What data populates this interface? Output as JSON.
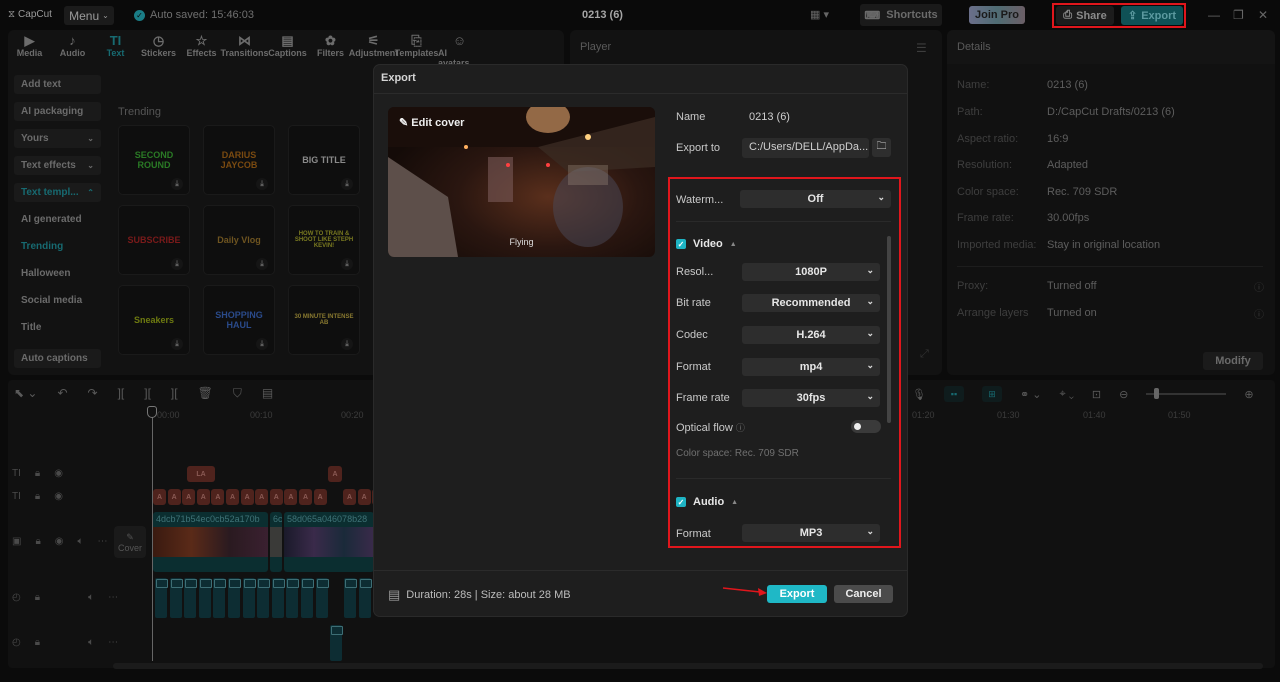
{
  "titlebar": {
    "app_name": "CapCut",
    "menu_label": "Menu",
    "autosave": "Auto saved: 15:46:03",
    "project_title": "0213 (6)",
    "shortcuts_label": "Shortcuts",
    "join_pro_label": "Join Pro",
    "share_label": "Share",
    "export_label": "Export"
  },
  "tool_tabs": [
    {
      "icon": "media-icon",
      "glyph": "▶",
      "label": "Media"
    },
    {
      "icon": "audio-icon",
      "glyph": "♪",
      "label": "Audio"
    },
    {
      "icon": "text-icon",
      "glyph": "TI",
      "label": "Text",
      "active": true
    },
    {
      "icon": "stickers-icon",
      "glyph": "◷",
      "label": "Stickers"
    },
    {
      "icon": "effects-icon",
      "glyph": "☆",
      "label": "Effects"
    },
    {
      "icon": "transitions-icon",
      "glyph": "⋈",
      "label": "Transitions"
    },
    {
      "icon": "captions-icon",
      "glyph": "▤",
      "label": "Captions"
    },
    {
      "icon": "filters-icon",
      "glyph": "✿",
      "label": "Filters"
    },
    {
      "icon": "adjustment-icon",
      "glyph": "⚟",
      "label": "Adjustment"
    },
    {
      "icon": "templates-icon",
      "glyph": "⎘",
      "label": "Templates"
    },
    {
      "icon": "ai-avatars-icon",
      "glyph": "☺",
      "label": "AI avatars"
    }
  ],
  "text_sidebar": [
    {
      "label": "Add text",
      "style": "button"
    },
    {
      "label": "AI packaging",
      "style": "button"
    },
    {
      "label": "Yours",
      "style": "button",
      "chevron": "⌄"
    },
    {
      "label": "Text effects",
      "style": "button",
      "chevron": "⌄"
    },
    {
      "label": "Text templ...",
      "style": "button teal",
      "chevron": "⌃"
    },
    {
      "label": "AI generated",
      "style": "plain"
    },
    {
      "label": "Trending",
      "style": "plain teal"
    },
    {
      "label": "Halloween",
      "style": "plain"
    },
    {
      "label": "Social media",
      "style": "plain"
    },
    {
      "label": "Title",
      "style": "plain"
    },
    {
      "label": "Auto captions",
      "style": "button"
    }
  ],
  "trending_label": "Trending",
  "templates": [
    {
      "text": "SECOND ROUND",
      "color": "#2a7a25"
    },
    {
      "text": "DARIUS JAYCOB",
      "color": "#7a4a10"
    },
    {
      "text": "BIG TITLE",
      "color": "#8a8a8a"
    },
    {
      "text": "SUBSCRIBE",
      "color": "#7a1a1a"
    },
    {
      "text": "Daily Vlog",
      "color": "#6e5420"
    },
    {
      "text": "HOW TO TRAIN & SHOOT LIKE STEPH KEVIN!",
      "color": "#7a7a20"
    },
    {
      "text": "Sneakers",
      "color": "#6e7a10"
    },
    {
      "text": "SHOPPING HAUL",
      "color": "#2a4a8a"
    },
    {
      "text": "30 MINUTE INTENSE AB",
      "color": "#8a7a30"
    }
  ],
  "player": {
    "label": "Player"
  },
  "details": {
    "title": "Details",
    "rows": [
      {
        "key": "Name:",
        "value": "0213 (6)"
      },
      {
        "key": "Path:",
        "value": "D:/CapCut Drafts/0213 (6)"
      },
      {
        "key": "Aspect ratio:",
        "value": "16:9"
      },
      {
        "key": "Resolution:",
        "value": "Adapted"
      },
      {
        "key": "Color space:",
        "value": "Rec. 709 SDR"
      },
      {
        "key": "Frame rate:",
        "value": "30.00fps"
      },
      {
        "key": "Imported media:",
        "value": "Stay in original location"
      },
      {
        "key": "Proxy:",
        "value": "Turned off"
      },
      {
        "key": "Arrange layers",
        "value": "Turned on"
      }
    ],
    "modify_label": "Modify"
  },
  "timeline": {
    "ruler": [
      "00:00",
      "00:10",
      "00:20",
      "01:20",
      "01:30",
      "01:40",
      "01:50"
    ],
    "cover_label": "Cover",
    "clip_names": [
      "4dcb71b54ec0cb52a170b",
      "6c",
      "58d065a046078b28"
    ],
    "text_clip_label": "A",
    "lyric_clip_label": "LA"
  },
  "export_dialog": {
    "title": "Export",
    "edit_cover": "Edit cover",
    "cover_caption": "Flying",
    "name_label": "Name",
    "name_value": "0213 (6)",
    "export_to_label": "Export to",
    "export_to_value": "C:/Users/DELL/AppDa...",
    "watermark_label": "Waterm...",
    "watermark_value": "Off",
    "video_section": "Video",
    "video_checked": true,
    "video_settings": [
      {
        "label": "Resol...",
        "value": "1080P"
      },
      {
        "label": "Bit rate",
        "value": "Recommended"
      },
      {
        "label": "Codec",
        "value": "H.264"
      },
      {
        "label": "Format",
        "value": "mp4"
      },
      {
        "label": "Frame rate",
        "value": "30fps"
      }
    ],
    "optical_flow_label": "Optical flow",
    "optical_flow_on": false,
    "color_space_note": "Color space: Rec. 709 SDR",
    "audio_section": "Audio",
    "audio_checked": true,
    "audio_format_label": "Format",
    "audio_format_value": "MP3",
    "duration_info": "Duration: 28s | Size: about 28 MB",
    "export_label": "Export",
    "cancel_label": "Cancel"
  },
  "colors": {
    "accent": "#1fb8c6",
    "annotation_red": "#e0161c"
  }
}
